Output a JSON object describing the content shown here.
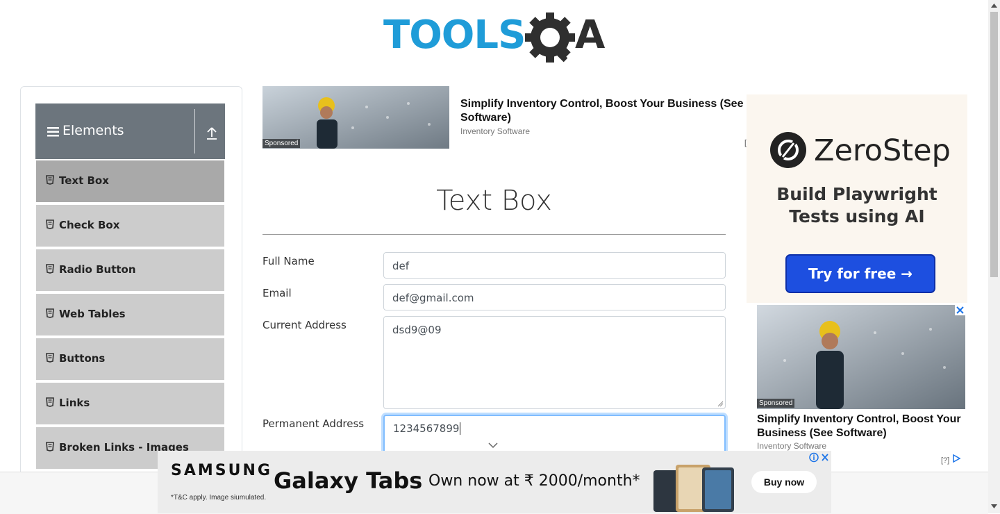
{
  "header": {
    "logo_text_left": "TOOLS",
    "logo_text_right": "A"
  },
  "sidebar": {
    "group_title": "Elements",
    "items": [
      {
        "label": "Text Box",
        "active": true
      },
      {
        "label": "Check Box"
      },
      {
        "label": "Radio Button"
      },
      {
        "label": "Web Tables"
      },
      {
        "label": "Buttons"
      },
      {
        "label": "Links"
      },
      {
        "label": "Broken Links - Images"
      }
    ]
  },
  "ad_top": {
    "sponsored": "Sponsored",
    "headline": "Simplify Inventory Control, Boost Your Business (See Software)",
    "source": "Inventory Software",
    "bracket": "["
  },
  "main": {
    "title": "Text Box",
    "fields": {
      "full_name": {
        "label": "Full Name",
        "value": "def"
      },
      "email": {
        "label": "Email",
        "value": "def@gmail.com"
      },
      "current_address": {
        "label": "Current Address",
        "value": "dsd9@09"
      },
      "permanent_address": {
        "label": "Permanent Address",
        "value": "1234567899"
      }
    }
  },
  "ad_right": {
    "brand": "ZeroStep",
    "tagline_1": "Build Playwright",
    "tagline_2": "Tests using AI",
    "cta": "Try for free →",
    "sponsored": "Sponsored",
    "headline": "Simplify Inventory Control, Boost Your Business (See Software)",
    "source": "Inventory Software",
    "help": "[?]"
  },
  "ad_bottom": {
    "brand": "SAMSUNG",
    "product": "Galaxy Tabs",
    "offer": "Own now at ₹ 2000/month*",
    "disclaimer": "*T&C apply. Image siumulated.",
    "cta": "Buy now"
  },
  "colors": {
    "logo_blue": "#1f9cd8",
    "logo_dark": "#2f2f2f",
    "sidebar_header": "#6c757d",
    "menu_item": "#cccccc",
    "menu_item_active": "#a9a9a9",
    "cta_blue": "#1d4fe0"
  }
}
